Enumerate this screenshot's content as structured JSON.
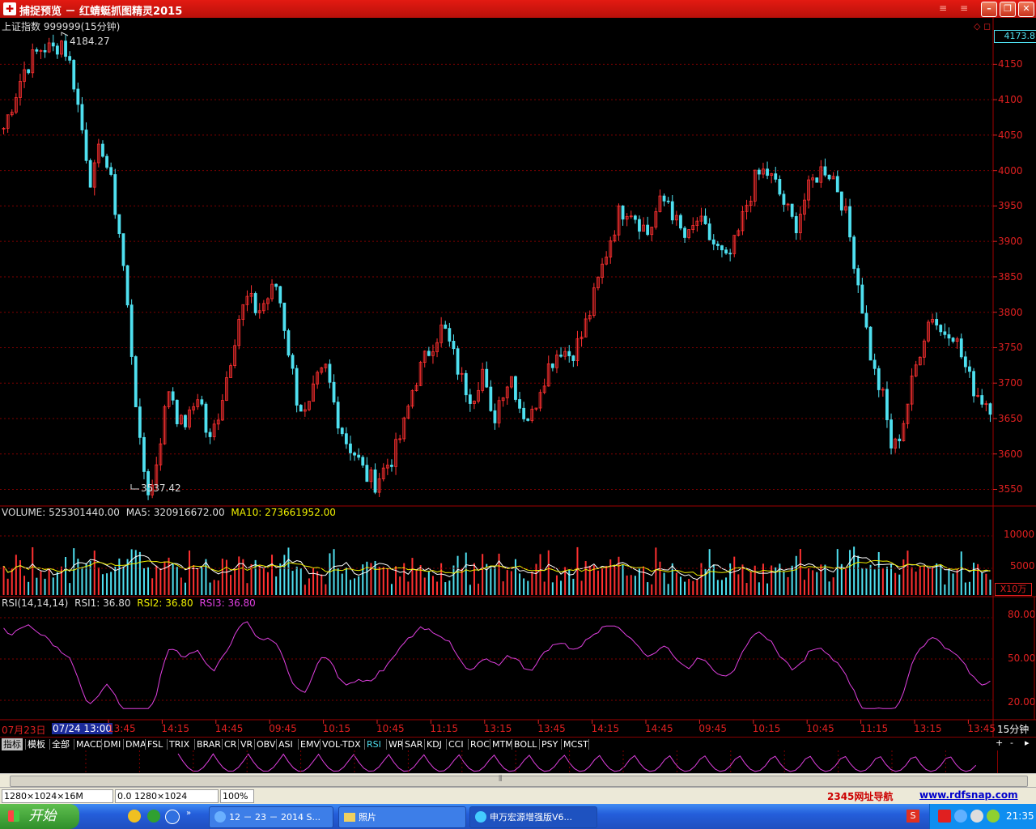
{
  "window": {
    "title": "捕捉预览 － 红蜻蜓抓图精灵2015",
    "icon": "app-logo-icon",
    "buttons": [
      "minimize",
      "maximize",
      "close"
    ]
  },
  "stock": {
    "name": "上证指数 999999(15分钟)",
    "current_price_tag": "4173.8",
    "high_label": "4184.27",
    "low_label": "3537.42"
  },
  "volume": {
    "label": "VOLUME: 525301440.00",
    "ma5": "MA5: 320916672.00",
    "ma10": "MA10: 273661952.00",
    "unit": "X10万",
    "ticks": [
      "10000",
      "5000"
    ]
  },
  "rsi": {
    "label": "RSI(14,14,14)",
    "rsi1": "RSI1: 36.80",
    "rsi2": "RSI2: 36.80",
    "rsi3": "RSI3: 36.80",
    "ticks": [
      "80.00",
      "50.00",
      "20.00"
    ]
  },
  "time_axis": {
    "date1": "07月23日",
    "date2": "07/24 13:00",
    "period": "15分钟",
    "ticks": [
      "13:45",
      "14:15",
      "14:45",
      "09:45",
      "10:15",
      "10:45",
      "11:15",
      "13:15",
      "13:45",
      "14:15",
      "14:45",
      "09:45",
      "10:15",
      "10:45",
      "11:15",
      "13:15",
      "13:45"
    ]
  },
  "indicator_tabs": [
    "指标",
    "模板",
    "全部",
    "MACD",
    "DMI",
    "DMA",
    "FSL",
    "TRIX",
    "BRAR",
    "CR",
    "VR",
    "OBV",
    "ASI",
    "EMV",
    "VOL-TDX",
    "RSI",
    "WR",
    "SAR",
    "KDJ",
    "CCI",
    "ROC",
    "MTM",
    "BOLL",
    "PSY",
    "MCST"
  ],
  "active_tab": "RSI",
  "statusbar": {
    "dims": "1280×1024×16M",
    "pos": "0.0 1280×1024",
    "zoom": "100%",
    "nav_link": "2345网址导航",
    "site_link": "www.rdfsnap.com"
  },
  "taskbar": {
    "start": "开始",
    "tasks": [
      "12 － 23 － 2014 S...",
      "照片",
      "申万宏源增强版V6..."
    ],
    "clock": "21:35"
  },
  "colors": {
    "up": "#ff3030",
    "down": "#4fe0f0",
    "grid": "#800000",
    "rsi": "#e040e0",
    "ma10": "#f0f000"
  },
  "chart_data": {
    "type": "candlestick",
    "y_axis": {
      "ticks": [
        4150,
        4100,
        4050,
        4000,
        3950,
        3900,
        3850,
        3800,
        3750,
        3700,
        3650,
        3600,
        3550
      ],
      "range": [
        3530,
        4195
      ]
    },
    "high": 4184.27,
    "low": 3537.42,
    "last": 4173.8,
    "close_path": [
      4060,
      4100,
      4140,
      4160,
      4175,
      4170,
      4184,
      4140,
      4060,
      3980,
      4040,
      3980,
      3900,
      3760,
      3600,
      3537,
      3620,
      3700,
      3640,
      3650,
      3690,
      3610,
      3660,
      3720,
      3790,
      3820,
      3800,
      3820,
      3840,
      3760,
      3680,
      3650,
      3700,
      3720,
      3660,
      3620,
      3600,
      3570,
      3560,
      3580,
      3600,
      3640,
      3700,
      3730,
      3760,
      3780,
      3740,
      3700,
      3680,
      3720,
      3640,
      3690,
      3710,
      3660,
      3650,
      3700,
      3730,
      3750,
      3740,
      3760,
      3800,
      3850,
      3900,
      3940,
      3950,
      3930,
      3910,
      3950,
      3960,
      3920,
      3900,
      3930,
      3910,
      3890,
      3870,
      3900,
      3950,
      3990,
      4000,
      3980,
      3950,
      3920,
      3960,
      3990,
      4005,
      3990,
      3950,
      3880,
      3800,
      3720,
      3680,
      3600,
      3640,
      3700,
      3760,
      3800,
      3770,
      3780,
      3740,
      3700,
      3680,
      3670
    ]
  }
}
